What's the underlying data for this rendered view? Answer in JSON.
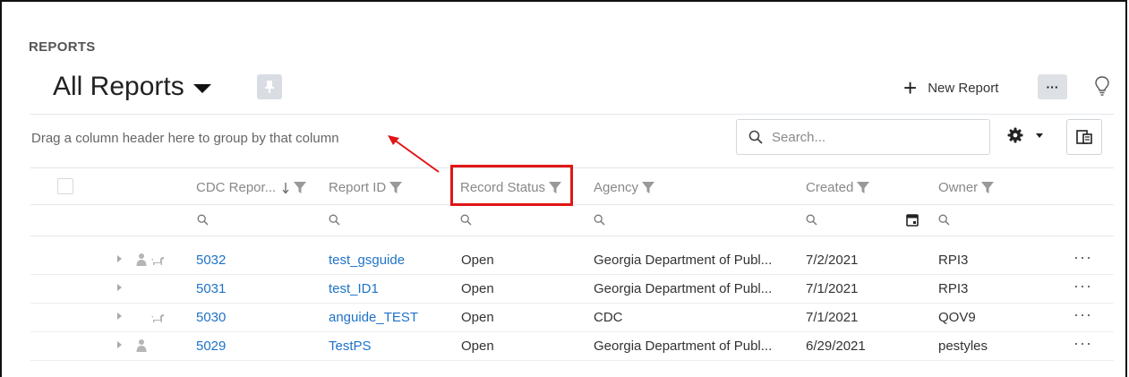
{
  "section_label": "REPORTS",
  "view": {
    "title": "All Reports"
  },
  "toolbar": {
    "new_report_label": "New Report",
    "more_label": "···"
  },
  "group_hint": "Drag a column header here to group by that column",
  "search": {
    "placeholder": "Search..."
  },
  "columns": [
    {
      "label": "CDC Repor...",
      "sorted": "descending",
      "filter_icon": "funnel-icon"
    },
    {
      "label": "Report ID",
      "filter_icon": "funnel-icon"
    },
    {
      "label": "Record Status",
      "filter_icon": "funnel-icon",
      "highlighted": true
    },
    {
      "label": "Agency",
      "filter_icon": "funnel-icon"
    },
    {
      "label": "Created",
      "filter_icon": "funnel-icon"
    },
    {
      "label": "Owner",
      "filter_icon": "funnel-icon"
    }
  ],
  "rows": [
    {
      "cdc_report": "5032",
      "report_id": "test_gsguide",
      "record_status": "Open",
      "agency": "Georgia Department of Publ...",
      "created": "7/2/2021",
      "owner": "RPI3",
      "icons": [
        "person-icon",
        "animal-icon"
      ]
    },
    {
      "cdc_report": "5031",
      "report_id": "test_ID1",
      "record_status": "Open",
      "agency": "Georgia Department of Publ...",
      "created": "7/1/2021",
      "owner": "RPI3",
      "icons": []
    },
    {
      "cdc_report": "5030",
      "report_id": "anguide_TEST",
      "record_status": "Open",
      "agency": "CDC",
      "created": "7/1/2021",
      "owner": "QOV9",
      "icons": [
        "animal-icon"
      ]
    },
    {
      "cdc_report": "5029",
      "report_id": "TestPS",
      "record_status": "Open",
      "agency": "Georgia Department of Publ...",
      "created": "6/29/2021",
      "owner": "pestyles",
      "icons": [
        "person-icon"
      ]
    }
  ],
  "row_action_label": "···",
  "colors": {
    "link": "#1f73c7",
    "highlight": "#e01616",
    "muted": "#888888"
  }
}
